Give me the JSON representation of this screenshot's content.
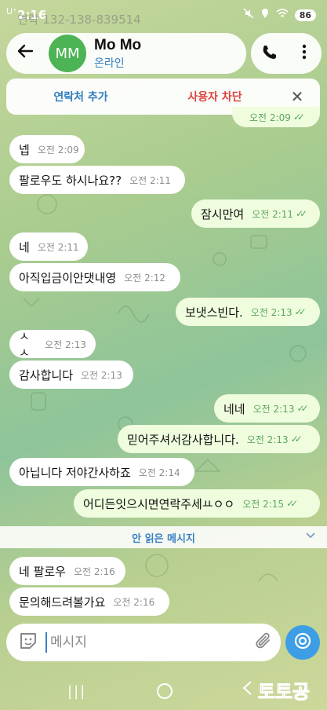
{
  "status_bar": {
    "time": "2:16",
    "carrier": "U⁺",
    "battery": "86"
  },
  "ghost_text": "연락 132-138-839514",
  "header": {
    "avatar_initials": "MM",
    "name": "Mo Mo",
    "status": "온라인"
  },
  "actions": {
    "add_contact": "연락처 추가",
    "block_user": "사용자 차단"
  },
  "messages": [
    {
      "dir": "out",
      "text": "",
      "time": "오전 2:09",
      "read": true
    },
    {
      "dir": "in",
      "text": "넵",
      "time": "오전 2:09"
    },
    {
      "dir": "in",
      "text": "팔로우도 하시나요??",
      "time": "오전 2:11"
    },
    {
      "dir": "out",
      "text": "잠시만여",
      "time": "오전 2:11",
      "read": true
    },
    {
      "dir": "in",
      "text": "네",
      "time": "오전 2:11"
    },
    {
      "dir": "in",
      "text": "아직입금이안댓내영",
      "time": "오전 2:12"
    },
    {
      "dir": "out",
      "text": "보냇스빈다.",
      "time": "오전 2:13",
      "read": true
    },
    {
      "dir": "in",
      "text": "ㅅㅅ",
      "time": "오전 2:13"
    },
    {
      "dir": "in",
      "text": "감사합니다",
      "time": "오전 2:13"
    },
    {
      "dir": "out",
      "text": "네네",
      "time": "오전 2:13",
      "read": true
    },
    {
      "dir": "out",
      "text": "믿어주셔서감사합니다.",
      "time": "오전 2:13",
      "read": true
    },
    {
      "dir": "in",
      "text": "아닙니다 저야간사하죠",
      "time": "오전 2:14"
    },
    {
      "dir": "out",
      "text": "어디든잇으시면연락주세ㅛㅇㅇ",
      "time": "오전 2:15",
      "read": true
    },
    {
      "dir": "in",
      "text": "네 팔로우",
      "time": "오전 2:16"
    },
    {
      "dir": "in",
      "text": "문의해드려볼가요",
      "time": "오전 2:16"
    }
  ],
  "unread_divider": "안 읽은 메시지",
  "composer": {
    "placeholder": "메시지"
  },
  "watermark": "토토공"
}
